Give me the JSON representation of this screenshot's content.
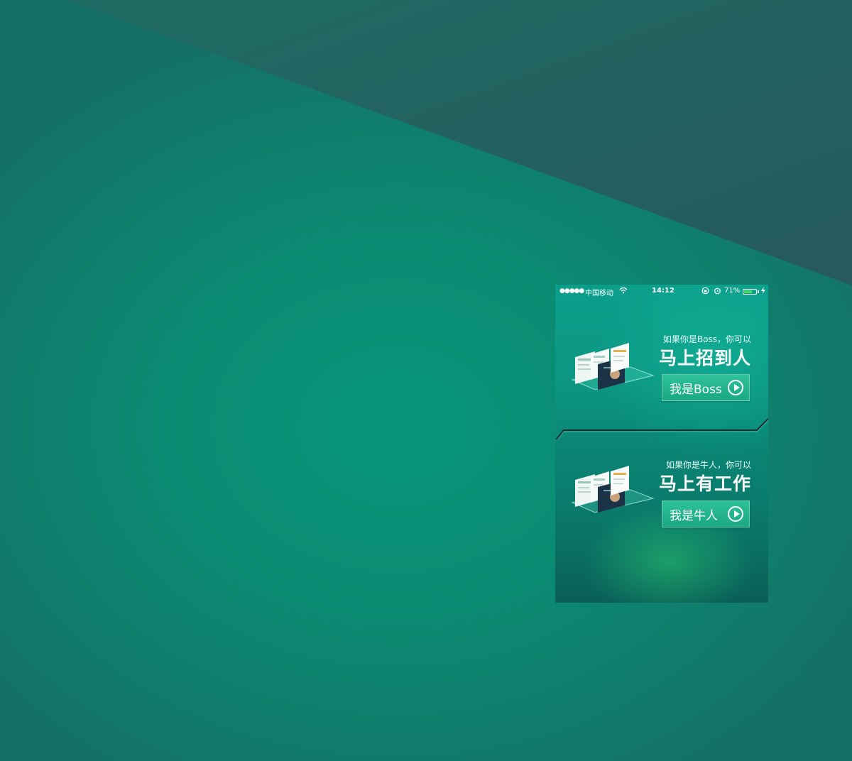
{
  "colors": {
    "background": "#0a8c73",
    "wedge": "#245f5e",
    "phone_accent": "#1aa882",
    "battery": "#4cd964"
  },
  "statusbar": {
    "signal": "●●●●●",
    "carrier": "中国移动",
    "wifi_icon": "wifi-icon",
    "time": "14:12",
    "battery_pct": "71%",
    "battery_level": 0.71
  },
  "boss_section": {
    "subtitle": "如果你是Boss，你可以",
    "headline": "马上招到人",
    "button_label": "我是Boss",
    "button_icon": "play-icon"
  },
  "talent_section": {
    "subtitle": "如果你是牛人，你可以",
    "headline": "马上有工作",
    "button_label": "我是牛人",
    "button_icon": "play-icon"
  }
}
